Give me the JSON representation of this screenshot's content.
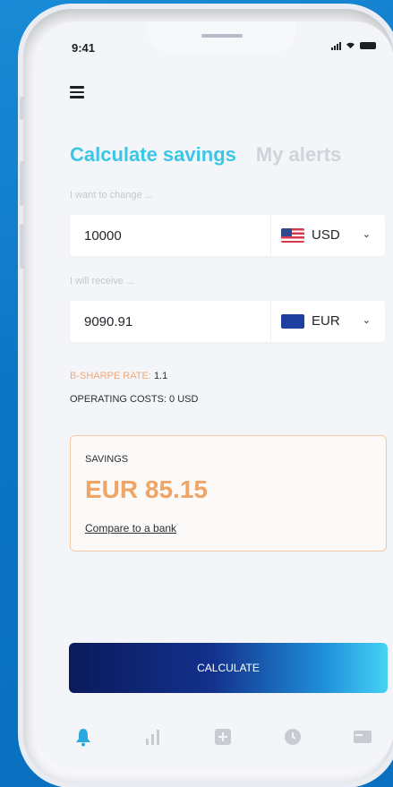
{
  "status": {
    "time": "9:41"
  },
  "tabs": [
    {
      "label": "Calculate savings",
      "active": true
    },
    {
      "label": "My alerts",
      "active": false
    }
  ],
  "send": {
    "label": "I want to change ...",
    "amount": "10000",
    "currency": "USD",
    "flag": "us-flag-icon"
  },
  "receive": {
    "label": "I will receive ...",
    "amount": "9090.91",
    "currency": "EUR",
    "flag": "eu-flag-icon"
  },
  "rate": {
    "label": "B-SHARPE RATE:",
    "value": "1.1"
  },
  "costs": {
    "text": "OPERATING COSTS: 0 USD"
  },
  "savings": {
    "label": "SAVINGS",
    "value": "EUR 85.15",
    "link": "Compare to a bank"
  },
  "calculate": {
    "label": "CALCULATE"
  },
  "nav": [
    {
      "icon": "bell-icon",
      "active": true
    },
    {
      "icon": "chart-icon",
      "active": false
    },
    {
      "icon": "plus-square-icon",
      "active": false
    },
    {
      "icon": "clock-icon",
      "active": false
    },
    {
      "icon": "card-icon",
      "active": false
    }
  ],
  "colors": {
    "accent": "#3cc6e6",
    "savings": "#eea566",
    "button_start": "#0a1a5c",
    "button_end": "#46d3f5",
    "background": "#0b74c4"
  }
}
